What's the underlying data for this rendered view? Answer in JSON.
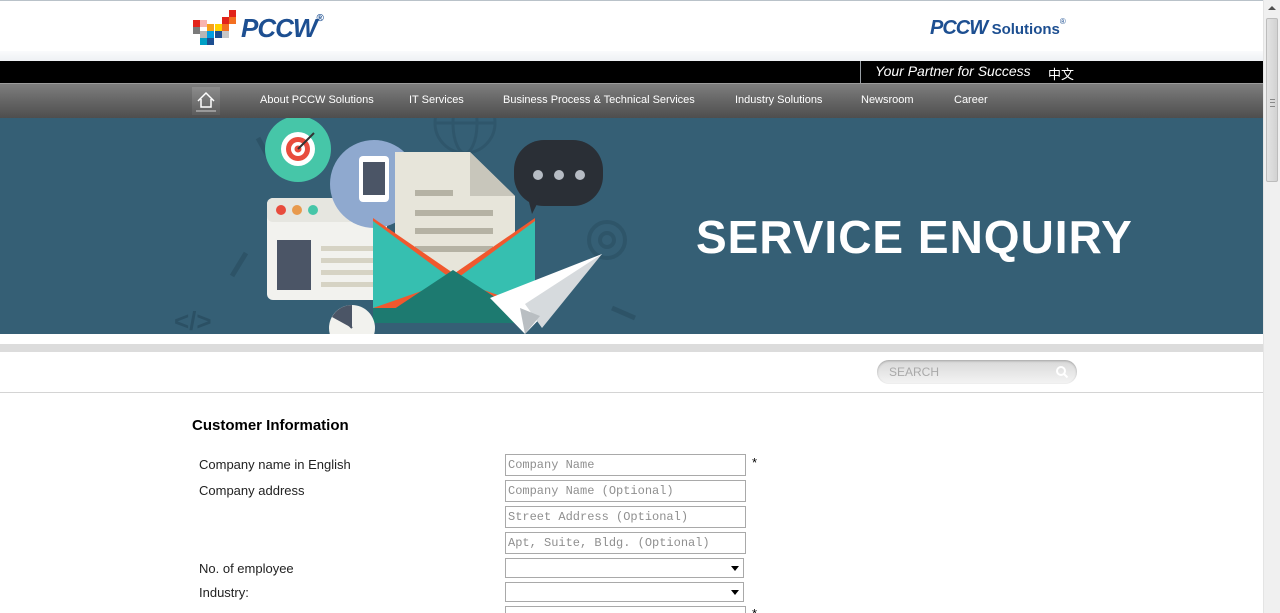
{
  "header": {
    "logo_left": "PCCW",
    "logo_right_brand": "PCCW",
    "logo_right_suffix": "Solutions",
    "registered_mark": "®"
  },
  "topbar": {
    "tagline": "Your Partner for Success",
    "language_link": "中文"
  },
  "nav": {
    "items": [
      {
        "label": "About PCCW Solutions"
      },
      {
        "label": "IT Services"
      },
      {
        "label": "Business Process & Technical Services"
      },
      {
        "label": "Industry Solutions"
      },
      {
        "label": "Newsroom"
      },
      {
        "label": "Career"
      }
    ]
  },
  "banner": {
    "title": "SERVICE ENQUIRY",
    "decor_text": "</>"
  },
  "search": {
    "placeholder": "SEARCH"
  },
  "form": {
    "section_title": "Customer Information",
    "company_name_label": "Company name in English",
    "company_name_placeholder": "Company Name",
    "company_address_label": "Company address",
    "address_line1_placeholder": "Company Name (Optional)",
    "address_line2_placeholder": "Street Address (Optional)",
    "address_line3_placeholder": "Apt, Suite, Bldg. (Optional)",
    "employees_label": "No. of employee",
    "industry_label": "Industry:",
    "required_mark": "*"
  },
  "colors": {
    "brand_blue": "#1d4f91",
    "banner_bg": "#355f75",
    "nav_bg": "#6a6a6a"
  }
}
